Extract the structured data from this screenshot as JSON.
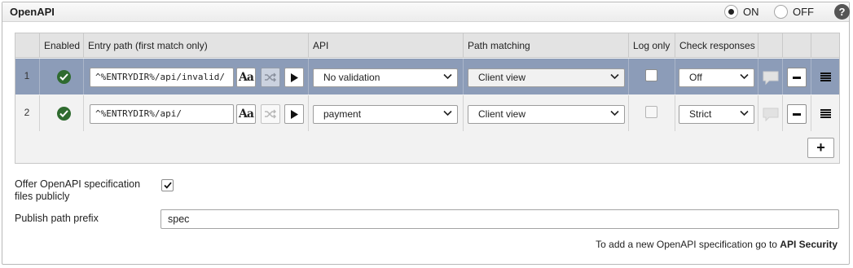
{
  "panel": {
    "title": "OpenAPI",
    "toggle": {
      "on_label": "ON",
      "off_label": "OFF",
      "selected": "ON"
    },
    "help_label": "?"
  },
  "table": {
    "columns": [
      "",
      "Enabled",
      "Entry path (first match only)",
      "API",
      "Path matching",
      "Log only",
      "Check responses",
      "",
      "",
      ""
    ],
    "rows": [
      {
        "num": "1",
        "enabled": true,
        "entry_path": "^%ENTRYDIR%/api/invalid/",
        "api": "No validation",
        "path_matching": "Client view",
        "log_only": false,
        "check_responses": "Off",
        "selected": true
      },
      {
        "num": "2",
        "enabled": true,
        "entry_path": "^%ENTRYDIR%/api/",
        "api": "payment",
        "path_matching": "Client view",
        "log_only": false,
        "check_responses": "Strict",
        "selected": false
      }
    ],
    "case_button_label": "Aa",
    "add_label": "+"
  },
  "options": {
    "offer_label": "Offer OpenAPI specification files publicly",
    "offer_checked": true,
    "prefix_label": "Publish path prefix",
    "prefix_value": "spec"
  },
  "footer": {
    "note_prefix": "To add a new OpenAPI specification go to ",
    "link_label": "API Security"
  },
  "colors": {
    "selected_row": "#8c9cb8",
    "enabled_green": "#2f6b2f"
  },
  "icons": [
    "check-circle-icon",
    "shuffle-icon",
    "play-icon",
    "chevron-down-icon",
    "comment-icon",
    "minus-icon",
    "menu-icon",
    "plus-icon",
    "help-icon"
  ]
}
